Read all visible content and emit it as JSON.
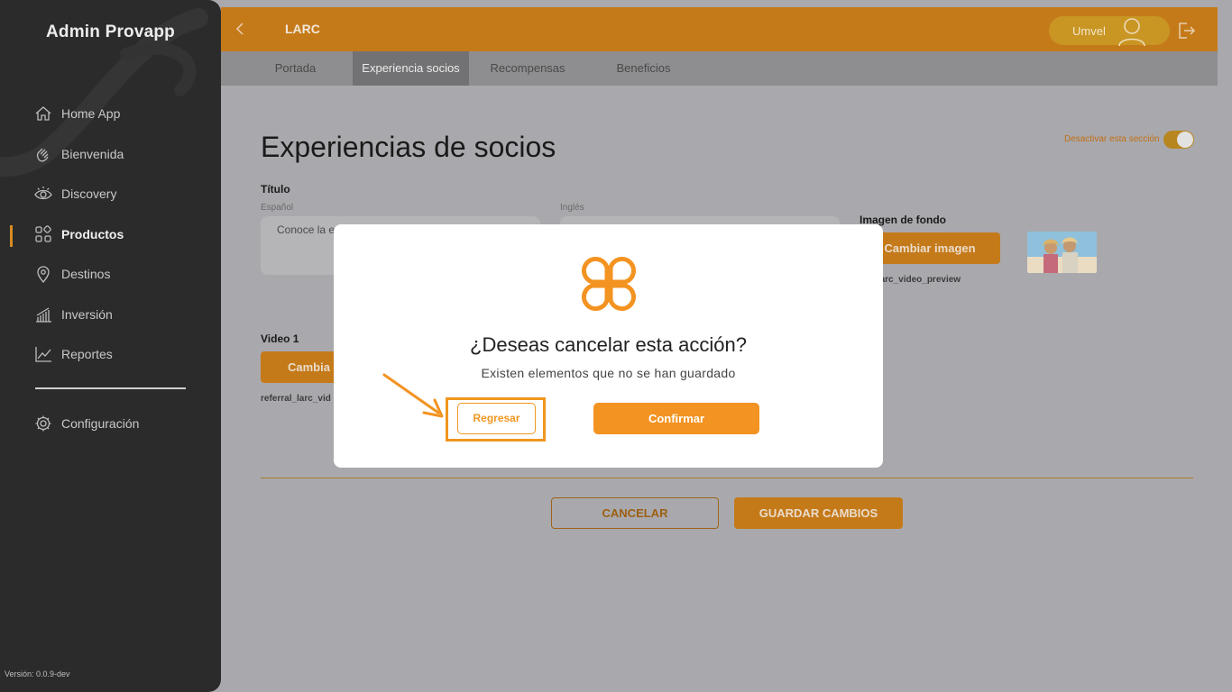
{
  "sidebar": {
    "title": "Admin Provapp",
    "items": [
      {
        "label": "Home App",
        "icon": "home-icon"
      },
      {
        "label": "Bienvenida",
        "icon": "wave-hand-icon"
      },
      {
        "label": "Discovery",
        "icon": "eye-icon"
      },
      {
        "label": "Productos",
        "icon": "grid-icon",
        "active": true
      },
      {
        "label": "Destinos",
        "icon": "location-pin-icon"
      },
      {
        "label": "Inversión",
        "icon": "bar-chart-icon"
      },
      {
        "label": "Reportes",
        "icon": "line-chart-icon"
      },
      {
        "label": "Configuración",
        "icon": "gear-icon"
      }
    ],
    "version": "Versión: 0.0.9-dev"
  },
  "topbar": {
    "page_name": "LARC",
    "user_name": "Umvel"
  },
  "tabs": [
    {
      "label": "Portada"
    },
    {
      "label": "Experiencia socios",
      "active": true
    },
    {
      "label": "Recompensas"
    },
    {
      "label": "Beneficios"
    }
  ],
  "main": {
    "title": "Experiencias de socios",
    "toggle_label": "Desactivar esta sección",
    "titulo_label": "Título",
    "espanol_label": "Español",
    "ingles_label": "Inglés",
    "espanol_value": "Conoce la e",
    "imagen_fondo_label": "Imagen de fondo",
    "cambiar_imagen": "Cambiar imagen",
    "imagen_filename": "ral_larc_video_preview",
    "video_label": "Video 1",
    "cambiar_video": "Cambia",
    "video_filename": "referral_larc_vid",
    "cancel_button": "CANCELAR",
    "save_button": "GUARDAR CAMBIOS"
  },
  "modal": {
    "title": "¿Deseas cancelar esta acción?",
    "subtitle": "Existen elementos que no se han guardado",
    "back_button": "Regresar",
    "confirm_button": "Confirmar"
  },
  "colors": {
    "accent": "#f39321",
    "sidebar_bg": "#2b2b2b",
    "topbar_bg": "#c57a1a"
  }
}
